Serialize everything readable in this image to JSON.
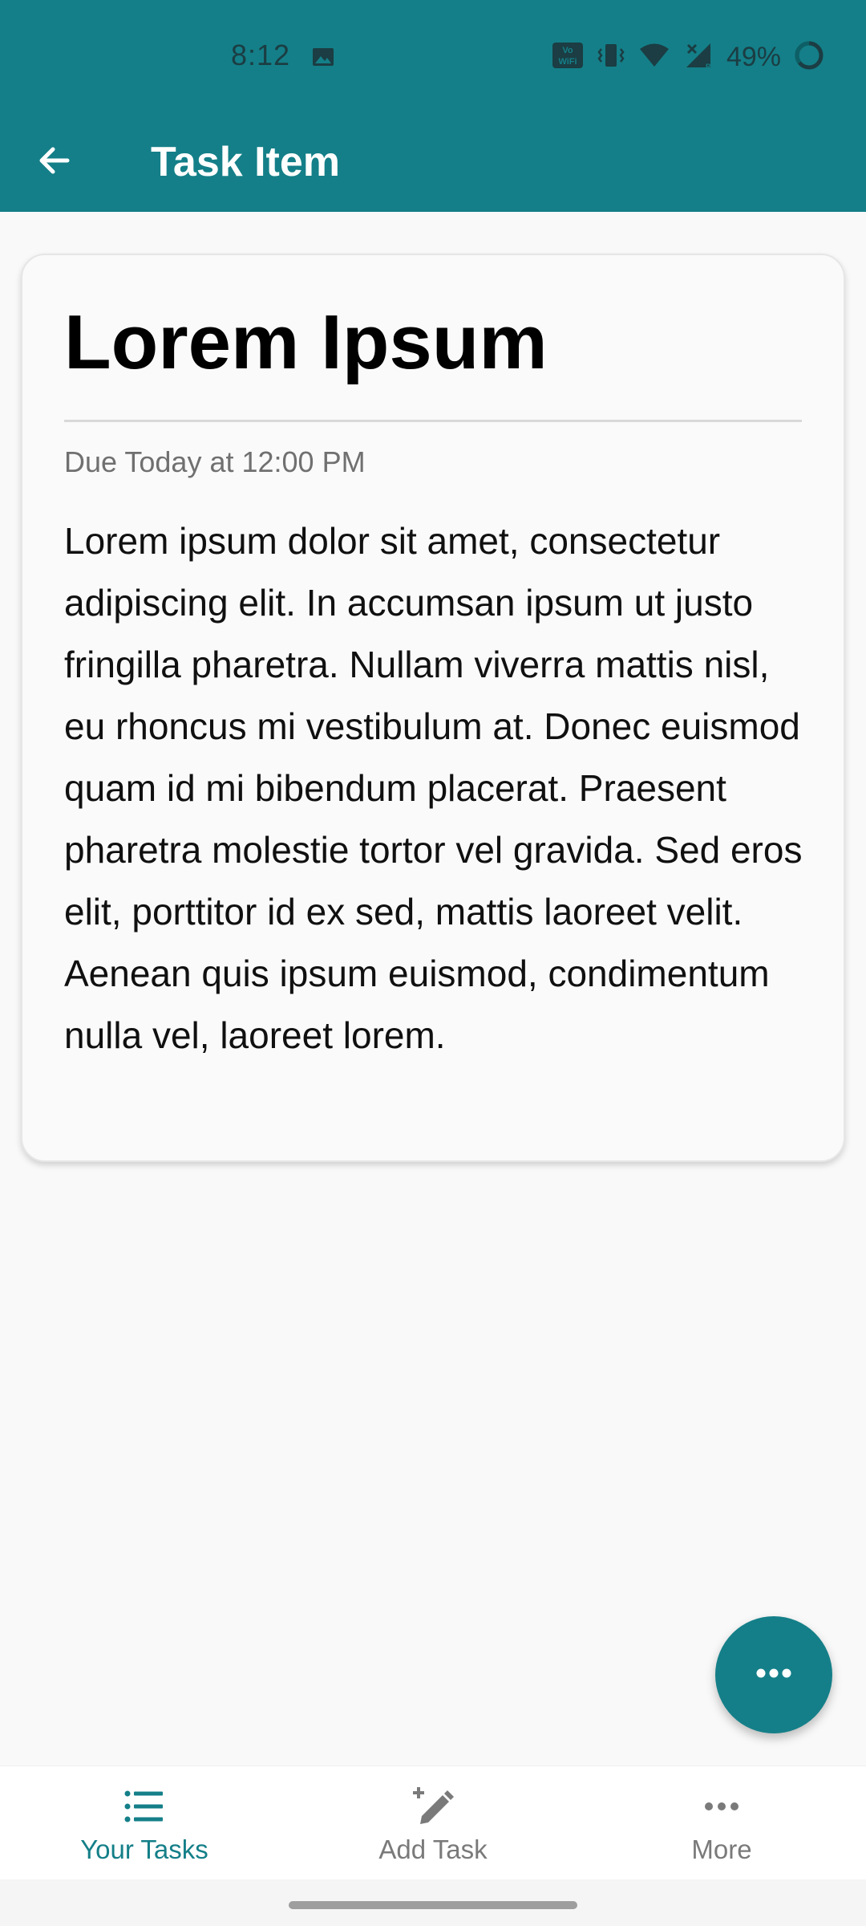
{
  "status_bar": {
    "time": "8:12",
    "battery_text": "49%",
    "icons": [
      "image-icon",
      "wifi-calling-icon",
      "vibrate-icon",
      "wifi-icon",
      "signal-icon",
      "battery-ring-icon"
    ]
  },
  "app_bar": {
    "title": "Task Item",
    "back_icon": "arrow-back-icon"
  },
  "task": {
    "title": "Lorem Ipsum",
    "due": "Due Today at 12:00 PM",
    "description": "Lorem ipsum dolor sit amet, consectetur adipiscing elit. In accumsan ipsum ut justo fringilla pharetra. Nullam viverra mattis nisl, eu rhoncus mi vestibulum at. Donec euismod quam id mi bibendum placerat. Praesent pharetra molestie tortor vel gravida. Sed eros elit, porttitor id ex sed, mattis laoreet velit. Aenean quis ipsum euismod, condimentum nulla vel, laoreet lorem."
  },
  "fab": {
    "icon": "more-horizontal-icon"
  },
  "bottom_nav": {
    "items": [
      {
        "label": "Your Tasks",
        "icon": "list-icon",
        "active": true
      },
      {
        "label": "Add Task",
        "icon": "edit-plus-icon",
        "active": false
      },
      {
        "label": "More",
        "icon": "more-horizontal-icon",
        "active": false
      }
    ]
  },
  "colors": {
    "primary": "#147f88",
    "background": "#f9f9f9",
    "card": "#fafafa",
    "inactive": "#7a7a7a"
  }
}
